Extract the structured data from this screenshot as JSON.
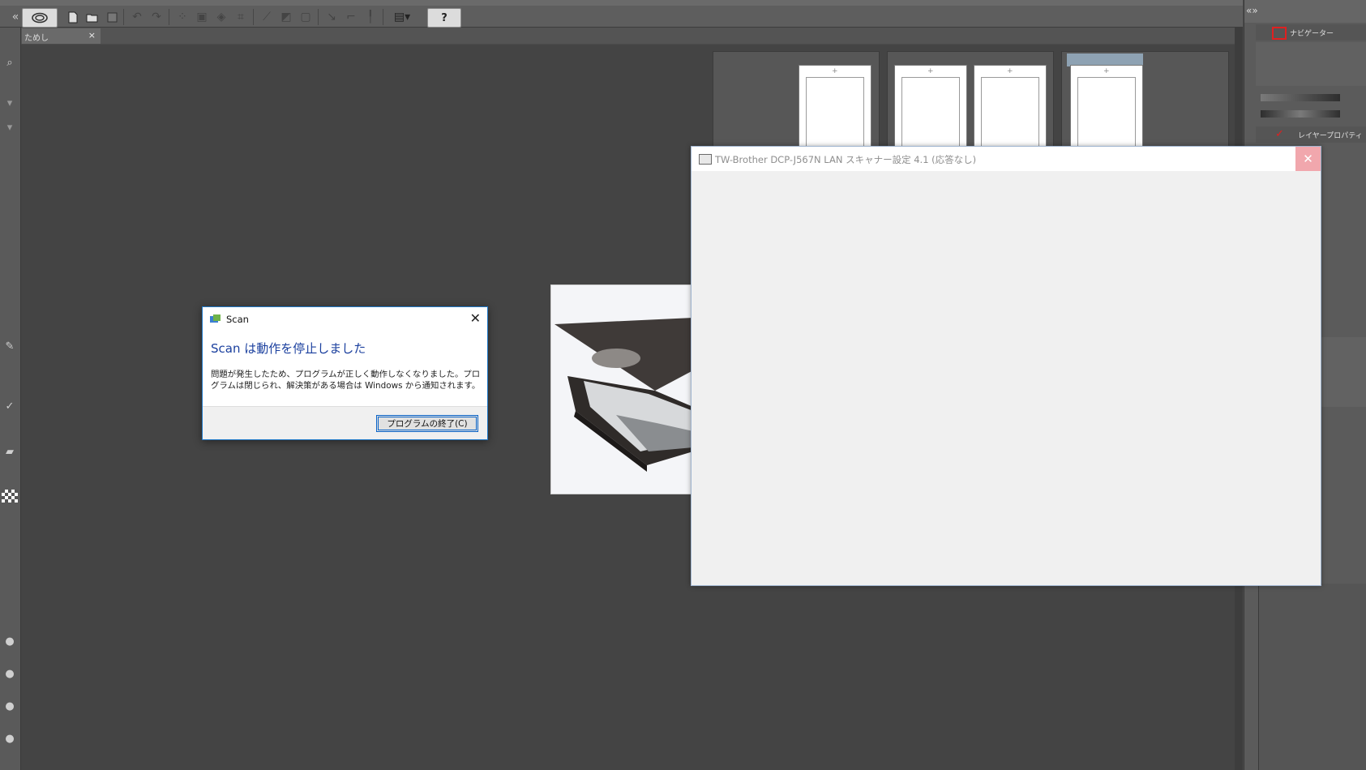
{
  "toolbar": {
    "collapse_icon": "«",
    "help_label": "?"
  },
  "document_tab": {
    "label": "ためし",
    "close": "×"
  },
  "right_panel": {
    "expand_icon": "«»",
    "navigator_label": "ナビゲーター",
    "layer_property_label": "レイヤープロパティ"
  },
  "tw_dialog": {
    "title": "TW-Brother DCP-J567N LAN スキャナー設定 4.1 (応答なし)",
    "close": "✕"
  },
  "error_dialog": {
    "title": "Scan",
    "close": "✕",
    "heading": "Scan は動作を停止しました",
    "message": "問題が発生したため、プログラムが正しく動作しなくなりました。プログラムは閉じられ、解決策がある場合は Windows から通知されます。",
    "button_label": "プログラムの終了(C)"
  },
  "colors": {
    "error_heading": "#1a3f9e",
    "dialog_border": "#1f78c8",
    "tw_close_bg": "#f1a7ad"
  }
}
